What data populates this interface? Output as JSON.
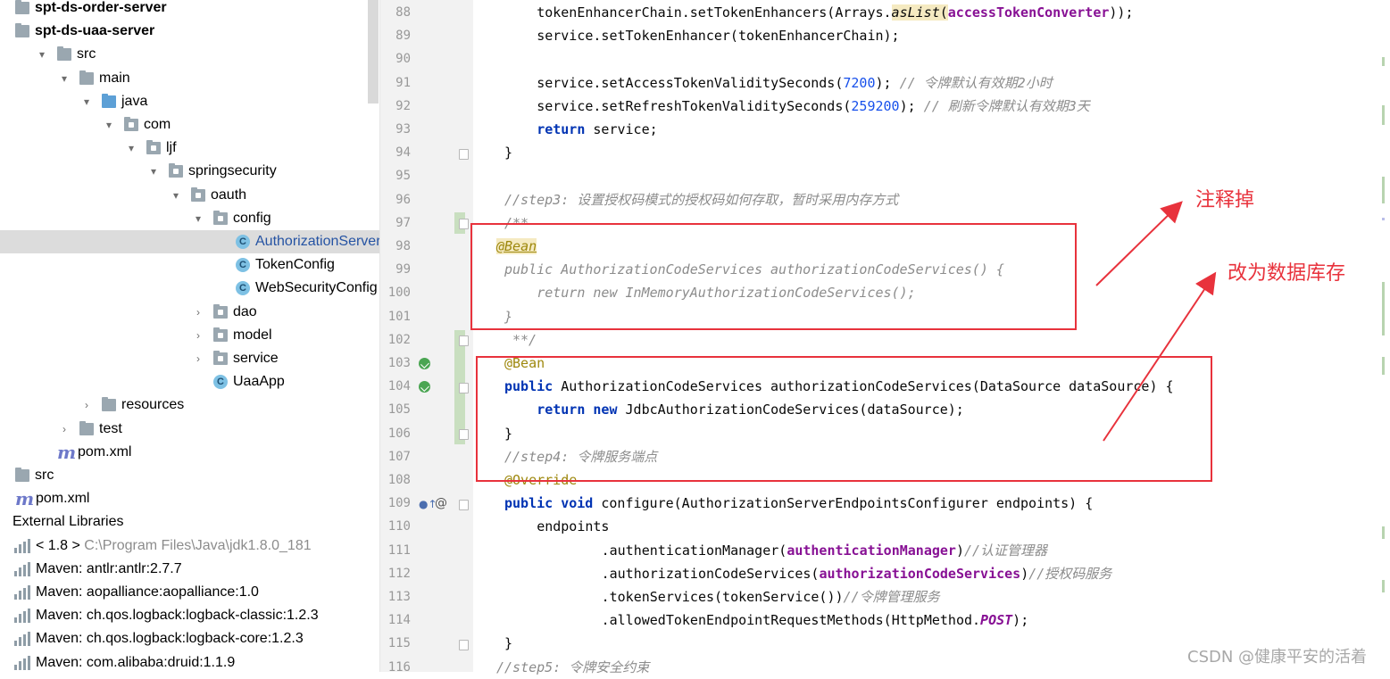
{
  "project_tree": [
    {
      "indent": 0,
      "arrow": "",
      "icon": "folder",
      "label": "spt-ds-order-server",
      "bold": true
    },
    {
      "indent": 0,
      "arrow": "▾",
      "icon": "folder",
      "label": "spt-ds-uaa-server",
      "bold": true
    },
    {
      "indent": 1,
      "arrow": "▾",
      "icon": "folder",
      "label": "src"
    },
    {
      "indent": 2,
      "arrow": "▾",
      "icon": "folder",
      "label": "main"
    },
    {
      "indent": 3,
      "arrow": "▾",
      "icon": "folder-blue",
      "label": "java"
    },
    {
      "indent": 4,
      "arrow": "▾",
      "icon": "package",
      "label": "com"
    },
    {
      "indent": 5,
      "arrow": "▾",
      "icon": "package",
      "label": "ljf"
    },
    {
      "indent": 6,
      "arrow": "▾",
      "icon": "package",
      "label": "springsecurity"
    },
    {
      "indent": 7,
      "arrow": "▾",
      "icon": "package",
      "label": "oauth"
    },
    {
      "indent": 8,
      "arrow": "▾",
      "icon": "package",
      "label": "config"
    },
    {
      "indent": 9,
      "arrow": "",
      "icon": "class",
      "label": "AuthorizationServer",
      "selected": true
    },
    {
      "indent": 9,
      "arrow": "",
      "icon": "class",
      "label": "TokenConfig"
    },
    {
      "indent": 9,
      "arrow": "",
      "icon": "class",
      "label": "WebSecurityConfig"
    },
    {
      "indent": 8,
      "arrow": "›",
      "icon": "package",
      "label": "dao"
    },
    {
      "indent": 8,
      "arrow": "›",
      "icon": "package",
      "label": "model"
    },
    {
      "indent": 8,
      "arrow": "›",
      "icon": "package",
      "label": "service"
    },
    {
      "indent": 8,
      "arrow": "",
      "icon": "app",
      "label": "UaaApp"
    },
    {
      "indent": 3,
      "arrow": "›",
      "icon": "folder",
      "label": "resources"
    },
    {
      "indent": 2,
      "arrow": "›",
      "icon": "folder",
      "label": "test"
    },
    {
      "indent": 1,
      "arrow": "",
      "icon": "maven",
      "label": "pom.xml"
    },
    {
      "indent": 0,
      "arrow": "",
      "icon": "folder",
      "label": "src"
    },
    {
      "indent": 0,
      "arrow": "",
      "icon": "maven",
      "label": "pom.xml"
    },
    {
      "indent": 0,
      "arrow": "",
      "icon": "libs",
      "label": "External Libraries",
      "no_icon": true
    },
    {
      "indent": 0,
      "arrow": "",
      "icon": "jdk",
      "label": "< 1.8 >",
      "suffix": "C:\\Program Files\\Java\\jdk1.8.0_181"
    },
    {
      "indent": 0,
      "arrow": "",
      "icon": "lib",
      "label": "Maven: antlr:antlr:2.7.7"
    },
    {
      "indent": 0,
      "arrow": "",
      "icon": "lib",
      "label": "Maven: aopalliance:aopalliance:1.0"
    },
    {
      "indent": 0,
      "arrow": "",
      "icon": "lib",
      "label": "Maven: ch.qos.logback:logback-classic:1.2.3"
    },
    {
      "indent": 0,
      "arrow": "",
      "icon": "lib",
      "label": "Maven: ch.qos.logback:logback-core:1.2.3"
    },
    {
      "indent": 0,
      "arrow": "",
      "icon": "lib",
      "label": "Maven: com.alibaba:druid:1.1.9"
    }
  ],
  "code_lines": [
    {
      "n": "88",
      "indent": 1,
      "tokens": [
        {
          "t": "tokenEnhancerChain.setTokenEnhancers(Arrays."
        },
        {
          "t": "asList",
          "c": "st hl"
        },
        {
          "t": "(",
          "c": "hl"
        },
        {
          "t": "accessTokenConverter",
          "c": "fld"
        },
        {
          "t": "));"
        }
      ]
    },
    {
      "n": "89",
      "indent": 1,
      "tokens": [
        {
          "t": "service.setTokenEnhancer(tokenEnhancerChain);"
        }
      ]
    },
    {
      "n": "90",
      "indent": 0,
      "tokens": []
    },
    {
      "n": "91",
      "indent": 1,
      "tokens": [
        {
          "t": "service.setAccessTokenValiditySeconds("
        },
        {
          "t": "7200",
          "c": "num"
        },
        {
          "t": "); "
        },
        {
          "t": "// 令牌默认有效期2小时",
          "c": "cm"
        }
      ]
    },
    {
      "n": "92",
      "indent": 1,
      "tokens": [
        {
          "t": "service.setRefreshTokenValiditySeconds("
        },
        {
          "t": "259200",
          "c": "num"
        },
        {
          "t": "); "
        },
        {
          "t": "// 刷新令牌默认有效期3天",
          "c": "cm"
        }
      ]
    },
    {
      "n": "93",
      "indent": 1,
      "tokens": [
        {
          "t": "return",
          "c": "kw"
        },
        {
          "t": " service;"
        }
      ]
    },
    {
      "n": "94",
      "indent": 0,
      "tokens": [
        {
          "t": "}"
        }
      ]
    },
    {
      "n": "95",
      "indent": 0,
      "tokens": []
    },
    {
      "n": "96",
      "indent": 0,
      "tokens": [
        {
          "t": "//step3: 设置授权码模式的授权码如何存取，暂时采用内存方式",
          "c": "cm"
        }
      ]
    },
    {
      "n": "97",
      "indent": 0,
      "tokens": [
        {
          "t": "/**",
          "c": "cm"
        }
      ]
    },
    {
      "n": "98",
      "indent": 0,
      "shift": -9,
      "tokens": [
        {
          "t": "@Bean",
          "c": "cm ann-u"
        }
      ]
    },
    {
      "n": "99",
      "indent": 0,
      "tokens": [
        {
          "t": "public AuthorizationCodeServices authorizationCodeServices() {",
          "c": "cm"
        }
      ]
    },
    {
      "n": "100",
      "indent": 1,
      "tokens": [
        {
          "t": "return new InMemoryAuthorizationCodeServices();",
          "c": "cm"
        }
      ]
    },
    {
      "n": "101",
      "indent": 0,
      "tokens": [
        {
          "t": "}",
          "c": "cm"
        }
      ]
    },
    {
      "n": "102",
      "indent": 0,
      "shift": 9,
      "tokens": [
        {
          "t": "**/",
          "c": "cm"
        }
      ]
    },
    {
      "n": "103",
      "indent": 0,
      "tokens": [
        {
          "t": "@Bean",
          "c": "ann"
        }
      ]
    },
    {
      "n": "104",
      "indent": 0,
      "tokens": [
        {
          "t": "public",
          "c": "kw"
        },
        {
          "t": " AuthorizationCodeServices authorizationCodeServices(DataSource dataSource) {"
        }
      ]
    },
    {
      "n": "105",
      "indent": 1,
      "tokens": [
        {
          "t": "return",
          "c": "kw"
        },
        {
          "t": " "
        },
        {
          "t": "new",
          "c": "kw"
        },
        {
          "t": " JdbcAuthorizationCodeServices(dataSource);"
        }
      ]
    },
    {
      "n": "106",
      "indent": 0,
      "tokens": [
        {
          "t": "}"
        }
      ]
    },
    {
      "n": "107",
      "indent": 0,
      "tokens": [
        {
          "t": "//step4: 令牌服务端点",
          "c": "cm"
        }
      ]
    },
    {
      "n": "108",
      "indent": 0,
      "tokens": [
        {
          "t": "@Override",
          "c": "ann"
        }
      ]
    },
    {
      "n": "109",
      "indent": 0,
      "tokens": [
        {
          "t": "public",
          "c": "kw"
        },
        {
          "t": " "
        },
        {
          "t": "void",
          "c": "kw"
        },
        {
          "t": " configure(AuthorizationServerEndpointsConfigurer endpoints) {"
        }
      ]
    },
    {
      "n": "110",
      "indent": 1,
      "tokens": [
        {
          "t": "endpoints"
        }
      ]
    },
    {
      "n": "111",
      "indent": 3,
      "tokens": [
        {
          "t": ".authenticationManager("
        },
        {
          "t": "authenticationManager",
          "c": "fld"
        },
        {
          "t": ")"
        },
        {
          "t": "//认证管理器",
          "c": "cm"
        }
      ]
    },
    {
      "n": "112",
      "indent": 3,
      "tokens": [
        {
          "t": ".authorizationCodeServices("
        },
        {
          "t": "authorizationCodeServices",
          "c": "fld"
        },
        {
          "t": ")"
        },
        {
          "t": "//授权码服务",
          "c": "cm"
        }
      ]
    },
    {
      "n": "113",
      "indent": 3,
      "tokens": [
        {
          "t": ".tokenServices(tokenService())"
        },
        {
          "t": "//令牌管理服务",
          "c": "cm"
        }
      ]
    },
    {
      "n": "114",
      "indent": 3,
      "tokens": [
        {
          "t": ".allowedTokenEndpointRequestMethods(HttpMethod."
        },
        {
          "t": "POST",
          "c": "st fld2"
        },
        {
          "t": ");"
        }
      ]
    },
    {
      "n": "115",
      "indent": 0,
      "tokens": [
        {
          "t": "}"
        }
      ]
    },
    {
      "n": "116",
      "indent": 0,
      "shift": -9,
      "tokens": [
        {
          "t": "//step5: 令牌安全约束",
          "c": "cm"
        }
      ]
    }
  ],
  "annotations": {
    "comment_out": "注释掉",
    "change_to_db": "改为数据库存"
  },
  "watermark": "CSDN @健康平安的活着",
  "colors": {
    "accent_red": "#e8323c",
    "keyword": "#0033b3",
    "comment": "#8c8c8c",
    "field": "#871094",
    "number": "#1750eb",
    "annotation": "#9e880d"
  }
}
